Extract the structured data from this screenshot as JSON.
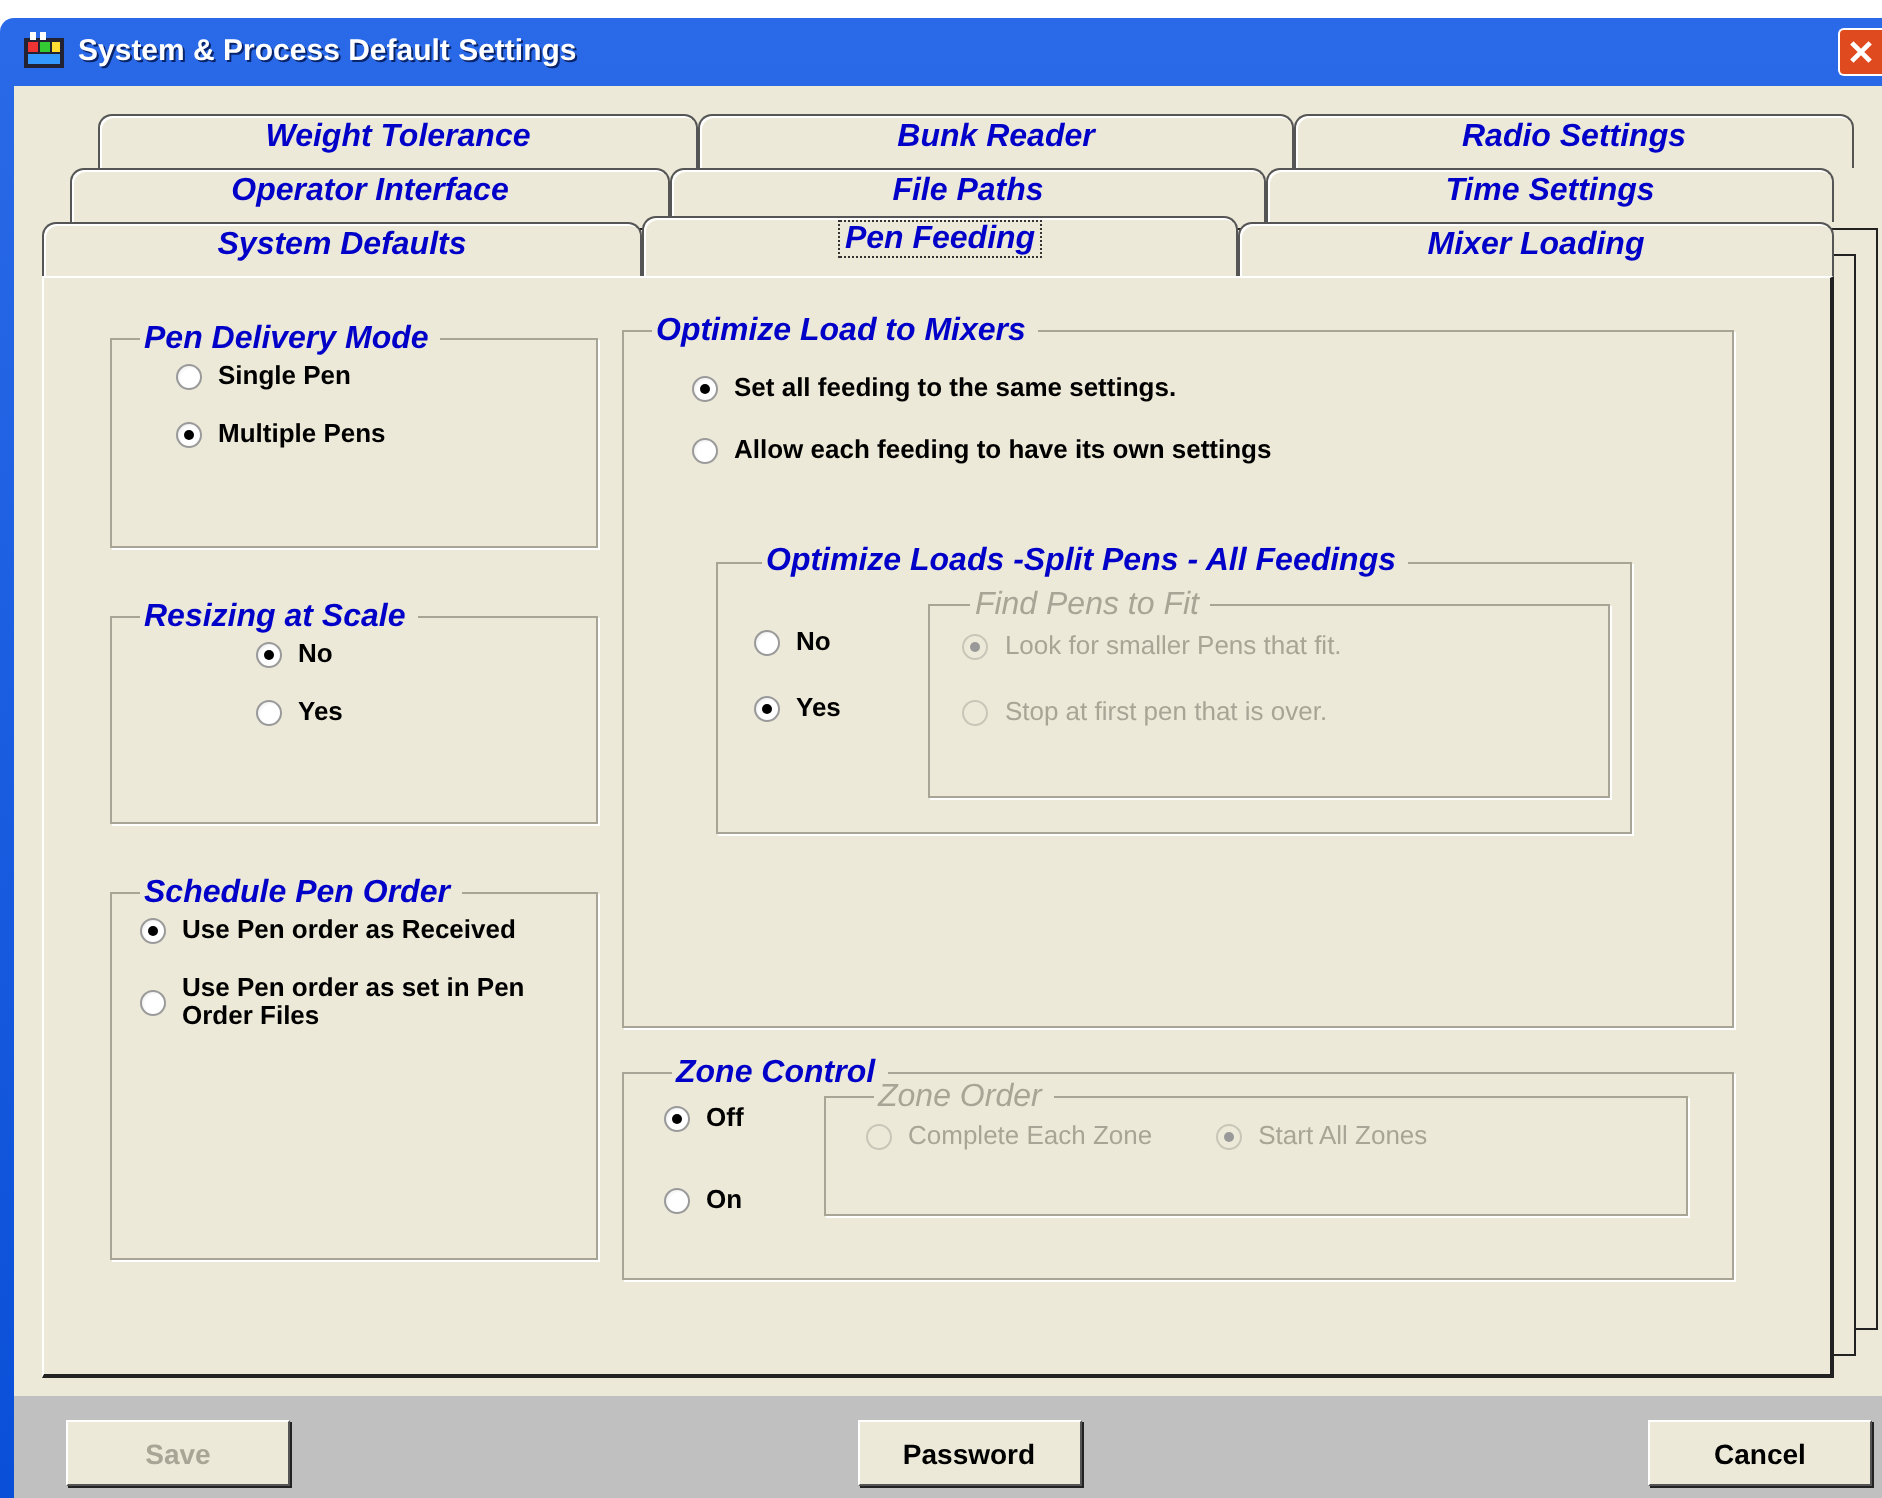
{
  "window": {
    "title": "System & Process Default Settings"
  },
  "tab_rows": [
    [
      {
        "label": "Weight Tolerance",
        "selected": false
      },
      {
        "label": "Bunk Reader",
        "selected": false
      },
      {
        "label": "Radio Settings",
        "selected": false
      }
    ],
    [
      {
        "label": "Operator Interface",
        "selected": false
      },
      {
        "label": "File Paths",
        "selected": false
      },
      {
        "label": "Time Settings",
        "selected": false
      }
    ],
    [
      {
        "label": "System Defaults",
        "selected": false
      },
      {
        "label": "Pen Feeding",
        "selected": true
      },
      {
        "label": "Mixer Loading",
        "selected": false
      }
    ]
  ],
  "left_groups": [
    {
      "title": "Pen Delivery Mode",
      "options": [
        {
          "label": "Single Pen",
          "selected": false,
          "disabled": false
        },
        {
          "label": "Multiple Pens",
          "selected": true,
          "disabled": false
        }
      ]
    },
    {
      "title": "Resizing at Scale",
      "options": [
        {
          "label": "No",
          "selected": true,
          "disabled": false
        },
        {
          "label": "Yes",
          "selected": false,
          "disabled": false
        }
      ]
    },
    {
      "title": "Schedule Pen Order",
      "options": [
        {
          "label": "Use Pen order as Received",
          "selected": true,
          "disabled": false
        },
        {
          "label": "Use Pen order as set in Pen Order Files",
          "selected": false,
          "disabled": false
        }
      ]
    }
  ],
  "optimize_load_to_mixers": {
    "title": "Optimize Load to Mixers",
    "options": [
      {
        "label": "Set all feeding to the same settings.",
        "selected": true,
        "disabled": false
      },
      {
        "label": "Allow each feeding to have its own settings",
        "selected": false,
        "disabled": false
      }
    ],
    "split_pens": {
      "title": "Optimize Loads -Split Pens - All Feedings",
      "options": [
        {
          "label": "No",
          "selected": false,
          "disabled": false
        },
        {
          "label": "Yes",
          "selected": true,
          "disabled": false
        }
      ],
      "find_pens": {
        "title": "Find Pens to Fit",
        "disabled": true,
        "options": [
          {
            "label": "Look for smaller Pens that fit.",
            "selected": true,
            "disabled": true
          },
          {
            "label": "Stop at first pen that is over.",
            "selected": false,
            "disabled": true
          }
        ]
      }
    }
  },
  "zone_control": {
    "title": "Zone Control",
    "options": [
      {
        "label": "Off",
        "selected": true,
        "disabled": false
      },
      {
        "label": "On",
        "selected": false,
        "disabled": false
      }
    ],
    "zone_order": {
      "title": "Zone Order",
      "disabled": true,
      "options": [
        {
          "label": "Complete Each Zone",
          "selected": false,
          "disabled": true
        },
        {
          "label": "Start All Zones",
          "selected": true,
          "disabled": true
        }
      ]
    }
  },
  "buttons": [
    {
      "label": "Save",
      "disabled": true
    },
    {
      "label": "Password",
      "disabled": false
    },
    {
      "label": "Cancel",
      "disabled": false
    }
  ]
}
